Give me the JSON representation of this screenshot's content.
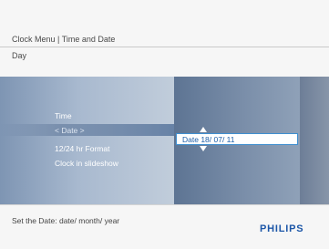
{
  "header": {
    "title": "Clock Menu | Time and Date",
    "subtitle": "Day"
  },
  "menu": {
    "items": [
      {
        "label": "Time"
      },
      {
        "label": "< Date >"
      },
      {
        "label": "12/24 hr Format"
      },
      {
        "label": "Clock in slideshow"
      }
    ]
  },
  "date_editor": {
    "value": "Date 18/ 07/ 11"
  },
  "footer": {
    "hint": "Set the Date: date/ month/ year",
    "logo": "PHILIPS"
  },
  "colors": {
    "accent": "#3f8fd0",
    "brand": "#1d57a8"
  }
}
